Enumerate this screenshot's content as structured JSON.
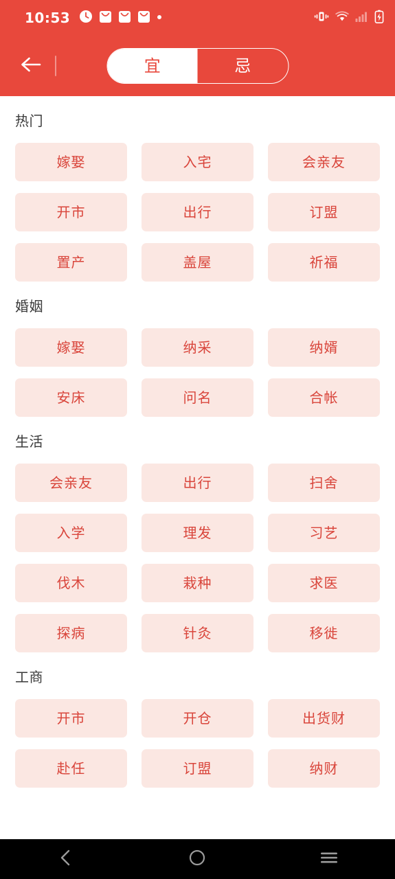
{
  "status_bar": {
    "time": "10:53",
    "left_icons": [
      "clock-icon",
      "message-icon",
      "message-icon",
      "message-icon",
      "dot-icon"
    ],
    "right_icons": [
      "vibrate-icon",
      "wifi-icon",
      "cellular-signal-icon",
      "battery-charging-icon"
    ],
    "background_color": "#E8483C",
    "text_color": "#FFFFFF"
  },
  "header": {
    "back_icon": "arrow-left-icon",
    "background_color": "#E8483C",
    "toggle": {
      "options": [
        {
          "label": "宜",
          "active": true
        },
        {
          "label": "忌",
          "active": false
        }
      ],
      "active_index": 0,
      "active_bg": "#FFFFFF",
      "active_text_color": "#E8483C",
      "inactive_text_color": "#FFFFFF"
    }
  },
  "theme": {
    "accent": "#E8483C",
    "chip_bg": "#FBE7E2",
    "chip_text": "#D9453B",
    "section_title_color": "#3A3A3A",
    "page_bg": "#FFFFFF"
  },
  "sections": [
    {
      "title": "热门",
      "chips": [
        "嫁娶",
        "入宅",
        "会亲友",
        "开市",
        "出行",
        "订盟",
        "置产",
        "盖屋",
        "祈福"
      ]
    },
    {
      "title": "婚姻",
      "chips": [
        "嫁娶",
        "纳采",
        "纳婿",
        "安床",
        "问名",
        "合帐"
      ]
    },
    {
      "title": "生活",
      "chips": [
        "会亲友",
        "出行",
        "扫舍",
        "入学",
        "理发",
        "习艺",
        "伐木",
        "栽种",
        "求医",
        "探病",
        "针灸",
        "移徙"
      ]
    },
    {
      "title": "工商",
      "chips": [
        "开市",
        "开仓",
        "出货财",
        "赴任",
        "订盟",
        "纳财"
      ]
    }
  ],
  "nav_bar": {
    "background_color": "#000000",
    "buttons": [
      {
        "name": "back-nav-button",
        "icon": "chevron-left-icon"
      },
      {
        "name": "home-nav-button",
        "icon": "circle-icon"
      },
      {
        "name": "recents-nav-button",
        "icon": "menu-icon"
      }
    ]
  }
}
